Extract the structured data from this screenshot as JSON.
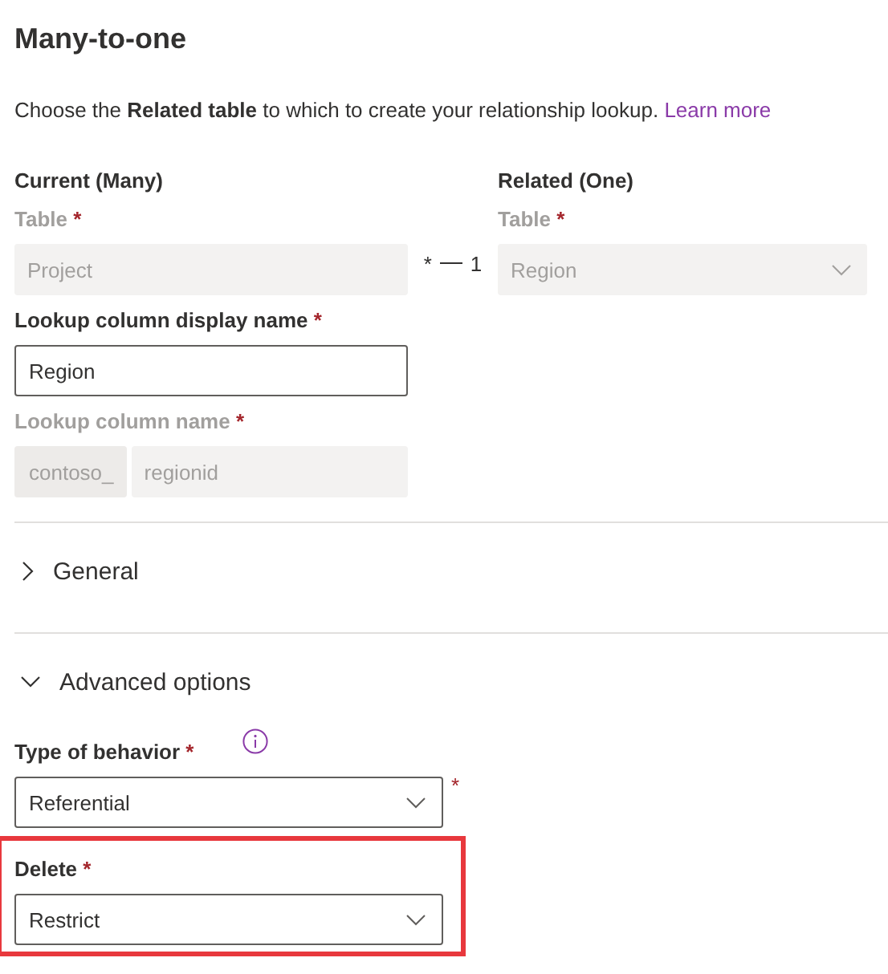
{
  "title": "Many-to-one",
  "intro": {
    "text": "Choose the **Related table** to which to create your relationship lookup.",
    "link": "Learn more"
  },
  "current": {
    "heading": "Current (Many)",
    "fields": [
      {
        "label": "Table",
        "marker": "*",
        "kind": "text",
        "value": "Project",
        "disabled": true
      },
      {
        "label": "Lookup column display name",
        "marker": "*",
        "kind": "text",
        "value": "Region",
        "disabled": false
      },
      {
        "label": "Lookup column name",
        "marker": "*",
        "kind": "prefixed",
        "prefix": "contoso_",
        "value": "regionid",
        "disabled": true
      }
    ]
  },
  "connector": {
    "many": "*",
    "one": "1"
  },
  "related": {
    "heading": "Related (One)",
    "fields": [
      {
        "label": "Table",
        "marker": "*",
        "kind": "dropdown",
        "value": "Region",
        "disabled": true
      }
    ]
  },
  "sections": [
    {
      "title": "General",
      "expanded": false
    },
    {
      "title": "Advanced options",
      "expanded": true
    }
  ],
  "advanced": [
    {
      "label": "Type of behavior",
      "marker": "*",
      "info": true,
      "value": "Referential",
      "outside_marker": "*",
      "highlighted": false
    },
    {
      "label": "Delete",
      "marker": "*",
      "info": false,
      "value": "Restrict",
      "highlighted": true
    }
  ]
}
